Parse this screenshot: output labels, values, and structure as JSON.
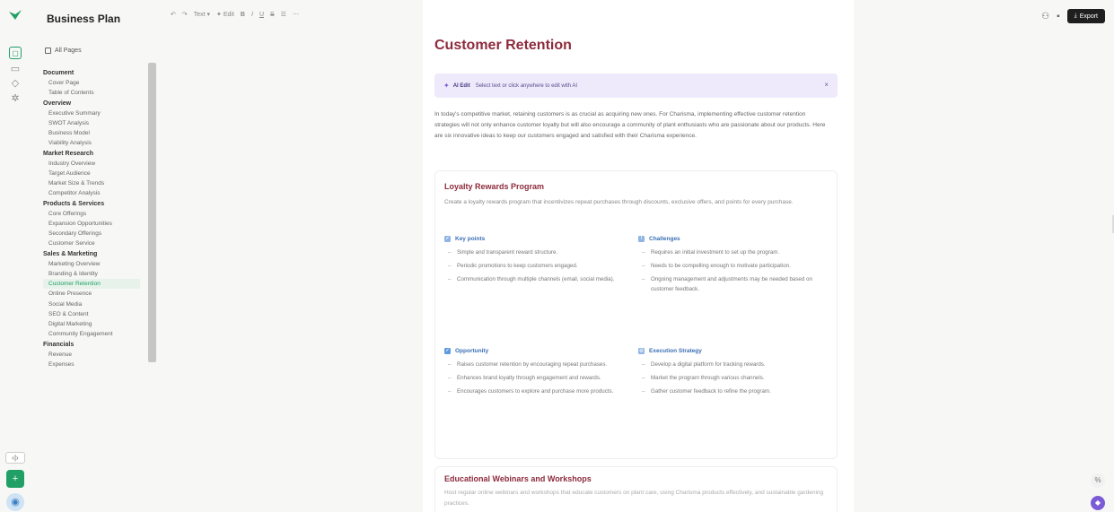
{
  "app": {
    "title": "Business Plan"
  },
  "sidebar": {
    "all_pages_label": "All Pages",
    "sections": [
      {
        "label": "Document",
        "items": [
          "Cover Page",
          "Table of Contents"
        ]
      },
      {
        "label": "Overview",
        "items": [
          "Executive Summary",
          "SWOT Analysis",
          "Business Model",
          "Viability Analysis"
        ]
      },
      {
        "label": "Market Research",
        "items": [
          "Industry Overview",
          "Target Audience",
          "Market Size & Trends",
          "Competitor Analysis"
        ]
      },
      {
        "label": "Products & Services",
        "items": [
          "Core Offerings",
          "Expansion Opportunities",
          "Secondary Offerings",
          "Customer Service"
        ]
      },
      {
        "label": "Sales & Marketing",
        "items": [
          "Marketing Overview",
          "Branding & Identity",
          "Customer Retention",
          "Online Presence",
          "Social Media",
          "SEO & Content",
          "Digital Marketing",
          "Community Engagement"
        ]
      },
      {
        "label": "Financials",
        "items": [
          "Revenue",
          "Expenses"
        ]
      }
    ],
    "active_item": "Customer Retention"
  },
  "toolbar": {
    "undo": "↶",
    "redo": "↷",
    "text_style": "Text ▾",
    "ai_edit": "✦ Edit",
    "bold": "B",
    "italic": "I",
    "underline": "U",
    "strike": "S",
    "list": "☰",
    "more": "⋯"
  },
  "topright": {
    "export_label": "Export"
  },
  "doc": {
    "title": "Customer Retention",
    "ai_bar": {
      "label": "AI Edit",
      "hint": "Select text or click anywhere to edit with AI",
      "close": "×"
    },
    "intro": "In today's competitive market, retaining customers is as crucial as acquiring new ones. For Charisma, implementing effective customer retention strategies will not only enhance customer loyalty but will also encourage a community of plant enthusiasts who are passionate about our products. Here are six innovative ideas to keep our customers engaged and satisfied with their Charisma experience.",
    "card1": {
      "title": "Loyalty Rewards Program",
      "desc": "Create a loyalty rewards program that incentivizes repeat purchases through discounts, exclusive offers, and points for every purchase.",
      "key_points": {
        "label": "Key points",
        "items": [
          "Simple and transparent reward structure.",
          "Periodic promotions to keep customers engaged.",
          "Communication through multiple channels (email, social media)."
        ]
      },
      "challenges": {
        "label": "Challenges",
        "items": [
          "Requires an initial investment to set up the program.",
          "Needs to be compelling enough to motivate participation.",
          "Ongoing management and adjustments may be needed based on customer feedback."
        ]
      },
      "opportunity": {
        "label": "Opportunity",
        "items": [
          "Raises customer retention by encouraging repeat purchases.",
          "Enhances brand loyalty through engagement and rewards.",
          "Encourages customers to explore and purchase more products."
        ]
      },
      "execution": {
        "label": "Execution Strategy",
        "items": [
          "Develop a digital platform for tracking rewards.",
          "Market the program through various channels.",
          "Gather customer feedback to refine the program."
        ]
      }
    },
    "card2": {
      "title": "Educational Webinars and Workshops",
      "desc": "Host regular online webinars and workshops that educate customers on plant care, using Charisma products effectively, and sustainable gardening practices."
    }
  },
  "colors": {
    "accent": "#20a065",
    "heading": "#8d2b3c",
    "ai_bg": "#efeafb",
    "ai_accent": "#7b5cd6",
    "key_points": "#5b8fd6",
    "challenges": "#5b8fd6",
    "opportunity": "#3d7fd6",
    "execution": "#5b8fd6"
  }
}
